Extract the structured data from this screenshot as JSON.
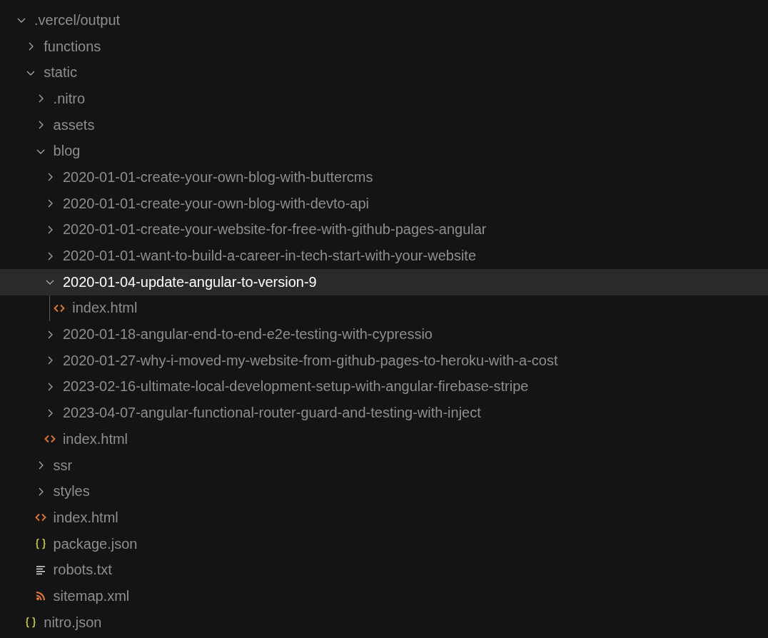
{
  "tree": [
    {
      "name": ".vercel/output",
      "kind": "folder",
      "expanded": true,
      "selected": false,
      "children": [
        {
          "name": "functions",
          "kind": "folder",
          "expanded": false,
          "selected": false
        },
        {
          "name": "static",
          "kind": "folder",
          "expanded": true,
          "selected": false,
          "children": [
            {
              "name": ".nitro",
              "kind": "folder",
              "expanded": false,
              "selected": false
            },
            {
              "name": "assets",
              "kind": "folder",
              "expanded": false,
              "selected": false
            },
            {
              "name": "blog",
              "kind": "folder",
              "expanded": true,
              "selected": false,
              "children": [
                {
                  "name": "2020-01-01-create-your-own-blog-with-buttercms",
                  "kind": "folder",
                  "expanded": false,
                  "selected": false
                },
                {
                  "name": "2020-01-01-create-your-own-blog-with-devto-api",
                  "kind": "folder",
                  "expanded": false,
                  "selected": false
                },
                {
                  "name": "2020-01-01-create-your-website-for-free-with-github-pages-angular",
                  "kind": "folder",
                  "expanded": false,
                  "selected": false
                },
                {
                  "name": "2020-01-01-want-to-build-a-career-in-tech-start-with-your-website",
                  "kind": "folder",
                  "expanded": false,
                  "selected": false
                },
                {
                  "name": "2020-01-04-update-angular-to-version-9",
                  "kind": "folder",
                  "expanded": true,
                  "selected": true,
                  "children": [
                    {
                      "name": "index.html",
                      "kind": "html",
                      "selected": false
                    }
                  ]
                },
                {
                  "name": "2020-01-18-angular-end-to-end-e2e-testing-with-cypressio",
                  "kind": "folder",
                  "expanded": false,
                  "selected": false
                },
                {
                  "name": "2020-01-27-why-i-moved-my-website-from-github-pages-to-heroku-with-a-cost",
                  "kind": "folder",
                  "expanded": false,
                  "selected": false
                },
                {
                  "name": "2023-02-16-ultimate-local-development-setup-with-angular-firebase-stripe",
                  "kind": "folder",
                  "expanded": false,
                  "selected": false
                },
                {
                  "name": "2023-04-07-angular-functional-router-guard-and-testing-with-inject",
                  "kind": "folder",
                  "expanded": false,
                  "selected": false
                },
                {
                  "name": "index.html",
                  "kind": "html",
                  "selected": false
                }
              ]
            },
            {
              "name": "ssr",
              "kind": "folder",
              "expanded": false,
              "selected": false
            },
            {
              "name": "styles",
              "kind": "folder",
              "expanded": false,
              "selected": false
            },
            {
              "name": "index.html",
              "kind": "html",
              "selected": false
            },
            {
              "name": "package.json",
              "kind": "json",
              "selected": false
            },
            {
              "name": "robots.txt",
              "kind": "text",
              "selected": false
            },
            {
              "name": "sitemap.xml",
              "kind": "rss",
              "selected": false
            }
          ]
        },
        {
          "name": "nitro.json",
          "kind": "json",
          "selected": false
        }
      ]
    }
  ]
}
